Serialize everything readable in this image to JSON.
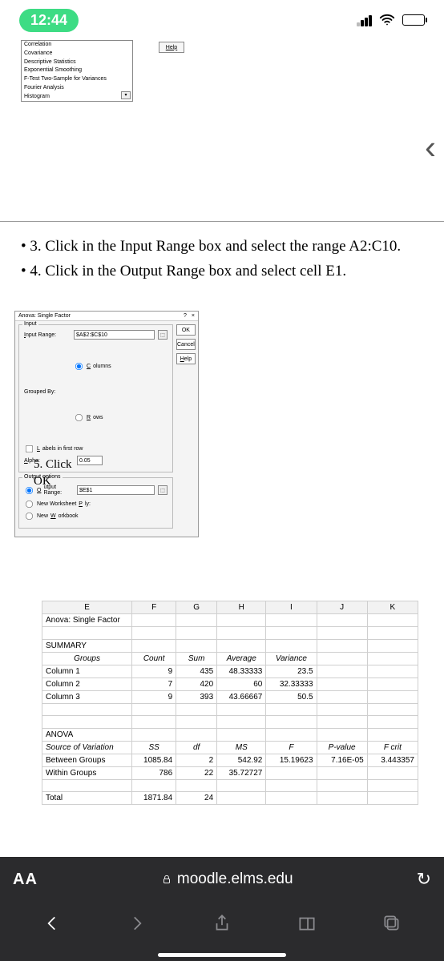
{
  "status": {
    "time": "12:44"
  },
  "tools": {
    "items": [
      "Correlation",
      "Covariance",
      "Descriptive Statistics",
      "Exponential Smoothing",
      "F-Test Two-Sample for Variances",
      "Fourier Analysis",
      "Histogram"
    ],
    "help": "Help"
  },
  "instructions": {
    "line1": "• 3. Click in the Input Range box and select the range A2:C10.",
    "line2": "• 4. Click in the Output Range box and select cell E1."
  },
  "dialog": {
    "title": "Anova: Single Factor",
    "close_q": "?",
    "close_x": "×",
    "input_legend": "Input",
    "input_range_label": "Input Range:",
    "input_range_value": "$A$2:$C$10",
    "grouped_by_label": "Grouped By:",
    "grouped_cols": "Columns",
    "grouped_rows": "Rows",
    "labels_first_row": "Labels in first row",
    "alpha_label": "Alpha:",
    "alpha_value": "0.05",
    "output_legend": "Output options",
    "output_range_label": "Output Range:",
    "output_range_value": "$E$1",
    "new_ws_ply": "New Worksheet Ply:",
    "new_wb": "New Workbook",
    "btn_ok": "OK",
    "btn_cancel": "Cancel",
    "btn_help": "Help"
  },
  "step5": {
    "l1": "5. Click",
    "l2": "OK"
  },
  "results": {
    "cols": [
      "E",
      "F",
      "G",
      "H",
      "I",
      "J",
      "K"
    ],
    "title": "Anova: Single Factor",
    "summary_hdr": "SUMMARY",
    "groups_hdr": "Groups",
    "count_hdr": "Count",
    "sum_hdr": "Sum",
    "avg_hdr": "Average",
    "var_hdr": "Variance",
    "rows": [
      {
        "g": "Column 1",
        "c": "9",
        "s": "435",
        "a": "48.33333",
        "v": "23.5"
      },
      {
        "g": "Column 2",
        "c": "7",
        "s": "420",
        "a": "60",
        "v": "32.33333"
      },
      {
        "g": "Column 3",
        "c": "9",
        "s": "393",
        "a": "43.66667",
        "v": "50.5"
      }
    ],
    "anova_hdr": "ANOVA",
    "sov": "Source of Variation",
    "ss": "SS",
    "df": "df",
    "ms": "MS",
    "f": "F",
    "pv": "P-value",
    "fc": "F crit",
    "bg": {
      "n": "Between Groups",
      "ss": "1085.84",
      "df": "2",
      "ms": "542.92",
      "f": "15.19623",
      "pv": "7.16E-05",
      "fc": "3.443357"
    },
    "wg": {
      "n": "Within Groups",
      "ss": "786",
      "df": "22",
      "ms": "35.72727"
    },
    "tot": {
      "n": "Total",
      "ss": "1871.84",
      "df": "24"
    }
  },
  "browser": {
    "aa": "AA",
    "url": "moodle.elms.edu"
  }
}
